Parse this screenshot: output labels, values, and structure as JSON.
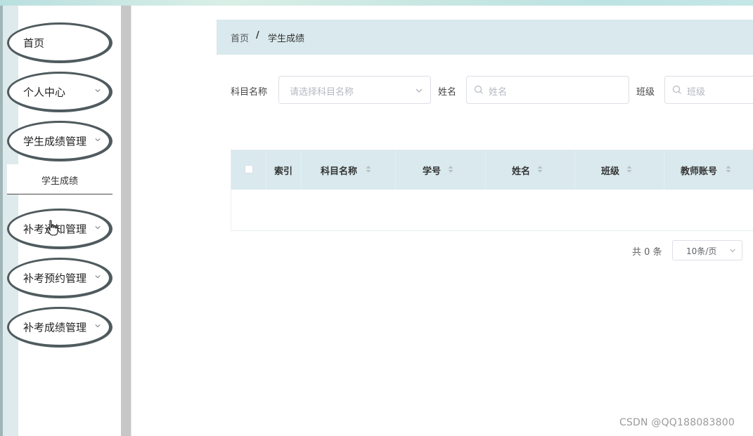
{
  "sidebar": {
    "items": [
      {
        "label": "首页",
        "has_children": false
      },
      {
        "label": "个人中心",
        "has_children": true
      },
      {
        "label": "学生成绩管理",
        "has_children": true,
        "expanded": true
      },
      {
        "label": "补考通知管理",
        "has_children": true
      },
      {
        "label": "补考预约管理",
        "has_children": true
      },
      {
        "label": "补考成绩管理",
        "has_children": true
      }
    ],
    "submenu": {
      "label": "学生成绩"
    }
  },
  "breadcrumb": {
    "home": "首页",
    "separator": "/",
    "current": "学生成绩"
  },
  "filters": {
    "subject": {
      "label": "科目名称",
      "placeholder": "请选择科目名称"
    },
    "name": {
      "label": "姓名",
      "placeholder": "姓名"
    },
    "class": {
      "label": "班级",
      "placeholder": "班级"
    }
  },
  "table": {
    "columns": [
      "索引",
      "科目名称",
      "学号",
      "姓名",
      "班级",
      "教师账号"
    ],
    "rows": []
  },
  "pagination": {
    "total_text": "共 0 条",
    "page_size": "10条/页"
  },
  "watermark": "CSDN @QQ188083800",
  "colors": {
    "accent_bg": "#d9e9ee",
    "sidebar_divider": "#c7c7c7",
    "menu_border": "#4f5b5e"
  },
  "icons": {
    "dropdown": "chevron-down-icon",
    "search": "search-icon",
    "sort": "sort-caret-icon",
    "cursor": "hand-pointer-icon"
  }
}
